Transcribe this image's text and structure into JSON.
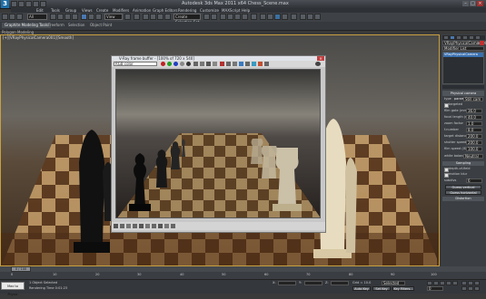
{
  "app": {
    "logo_text": "3",
    "title": "Autodesk 3ds Max 2011 x64      Chess_Scene.max",
    "window_controls": [
      "–",
      "□",
      "×"
    ]
  },
  "menus": [
    "Edit",
    "Tools",
    "Group",
    "Views",
    "Create",
    "Modifiers",
    "Animation",
    "Graph Editors",
    "Rendering",
    "Customize",
    "MAXScript",
    "Help"
  ],
  "toolbar": {
    "selection_filter": "All",
    "refcoord": "View",
    "named_selection": "Create Selection Set"
  },
  "ribbon": {
    "tabs": [
      "Graphite Modeling Tools",
      "Freeform",
      "Selection",
      "Object Paint"
    ],
    "active_tab": "Graphite Modeling Tools",
    "sub_label": "Polygon Modeling"
  },
  "viewport": {
    "label": "[+][VRayPhysicalCamera001][Smooth]"
  },
  "render_frame": {
    "title": "V-Ray frame buffer - [100% of 720 x 540]",
    "channel": "RGB color",
    "color_swatches": [
      "#c02020",
      "#20a020",
      "#2040c0",
      "#888888"
    ]
  },
  "command_panel": {
    "object_name": "VRayPhysicalCamera001",
    "modifier_list_label": "Modifier List",
    "stack_item": "VRayPhysicalCamera",
    "section_title": "Physical camera parameters",
    "type_label": "type",
    "type_value": "Still cam",
    "targeted_label": "targeted",
    "params": [
      {
        "label": "film gate (mm)",
        "value": "36.0"
      },
      {
        "label": "focal length (mm)",
        "value": "40.0"
      },
      {
        "label": "zoom factor",
        "value": "1.0"
      },
      {
        "label": "f-number",
        "value": "8.0"
      },
      {
        "label": "target distance",
        "value": "200.0"
      },
      {
        "label": "shutter speed (s^-1)",
        "value": "200.0"
      },
      {
        "label": "film speed (ISO)",
        "value": "100.0"
      }
    ],
    "white_balance_label": "white balance",
    "white_balance_value": "Neutral",
    "sampling_title": "Sampling",
    "depth_of_field_label": "depth-of-field",
    "motion_blur_label": "motion blur",
    "subdivs_label": "subdivs",
    "subdivs_value": "6",
    "guess_btn": "Guess vertical",
    "guess_btn2": "Guess horizontal",
    "bottom_btn": "Distortion"
  },
  "timeline": {
    "frame": "0 / 100",
    "ticks": [
      "0",
      "10",
      "20",
      "30",
      "40",
      "50",
      "60",
      "70",
      "80",
      "90",
      "100"
    ]
  },
  "status": {
    "left_btn": "Max to Physic",
    "selected_text": "1 Object Selected",
    "render_time": "Rendering Time  0:01:23",
    "x_label": "X:",
    "x_value": "",
    "y_label": "Y:",
    "y_value": "",
    "z_label": "Z:",
    "z_value": "",
    "grid": "Grid = 10.0",
    "autokey": "Auto Key",
    "selected_dropdown": "Selected",
    "setkey": "Set Key",
    "keyfilters": "Key Filters...",
    "frame_field": "0"
  }
}
